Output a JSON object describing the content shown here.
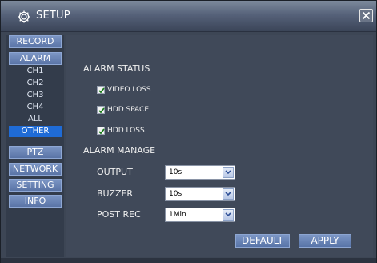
{
  "window": {
    "title": "SETUP",
    "title_icon": "gear-icon",
    "close_icon": "close-icon"
  },
  "sidebar": {
    "record": "RECORD",
    "alarm": "ALARM",
    "alarm_items": [
      "CH1",
      "CH2",
      "CH3",
      "CH4",
      "ALL",
      "OTHER"
    ],
    "selected_item": "OTHER",
    "ptz": "PTZ",
    "network": "NETWORK",
    "setting": "SETTING",
    "info": "INFO"
  },
  "alarm_status": {
    "heading": "ALARM STATUS",
    "items": [
      {
        "label": "VIDEO LOSS",
        "checked": true
      },
      {
        "label": "HDD SPACE",
        "checked": true
      },
      {
        "label": "HDD LOSS",
        "checked": true
      }
    ]
  },
  "alarm_manage": {
    "heading": "ALARM MANAGE",
    "output_label": "OUTPUT",
    "output_value": "10s",
    "buzzer_label": "BUZZER",
    "buzzer_value": "10s",
    "post_rec_label": "POST REC",
    "post_rec_value": "1Min"
  },
  "buttons": {
    "default": "DEFAULT",
    "apply": "APPLY"
  },
  "colors": {
    "panel": "#404959",
    "selected": "#1f6bd6",
    "button": "#6a84b6"
  }
}
